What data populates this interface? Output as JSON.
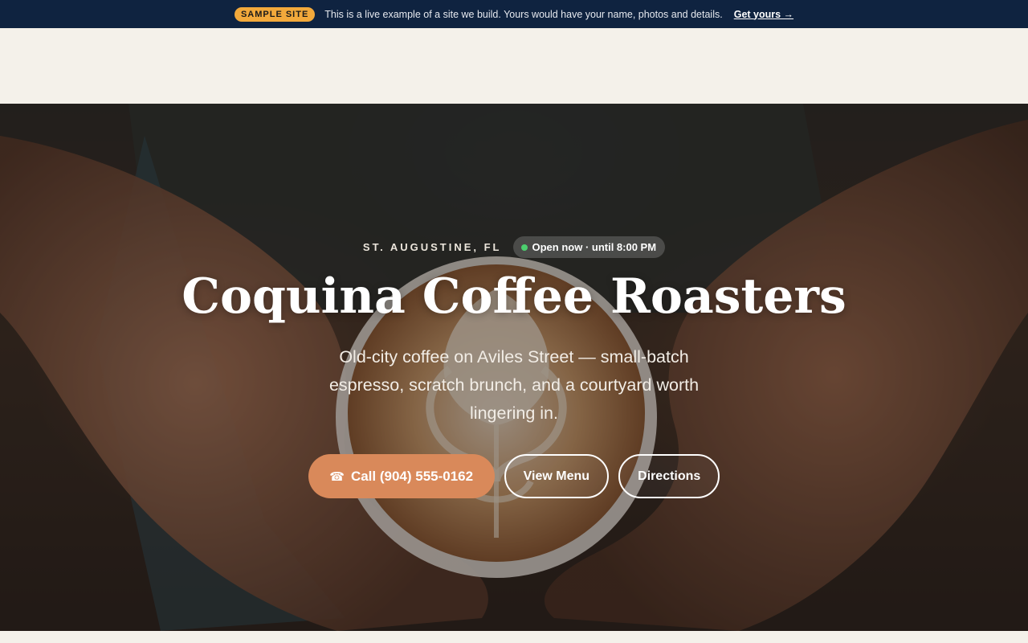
{
  "banner": {
    "badge": "SAMPLE SITE",
    "text": "This is a live example of a site we build. Yours would have your name, photos and details.",
    "link": "Get yours →"
  },
  "hero": {
    "location": "ST. AUGUSTINE, FL",
    "open_status": "Open now · until 8:00 PM",
    "title": "Coquina Coffee Roasters",
    "subtitle": "Old-city coffee on Aviles Street — small-batch espresso, scratch brunch, and a courtyard worth lingering in.",
    "buttons": {
      "call": "Call (904) 555-0162",
      "call_icon": "☎",
      "menu": "View Menu",
      "directions": "Directions"
    },
    "image_alt": "hands-holding-latte-photo"
  },
  "colors": {
    "banner_bg": "#0f2340",
    "badge": "#f2a93b",
    "primary_button": "#d9895a",
    "page_bg": "#f4f1ea",
    "open_dot": "#4ccf6e"
  }
}
